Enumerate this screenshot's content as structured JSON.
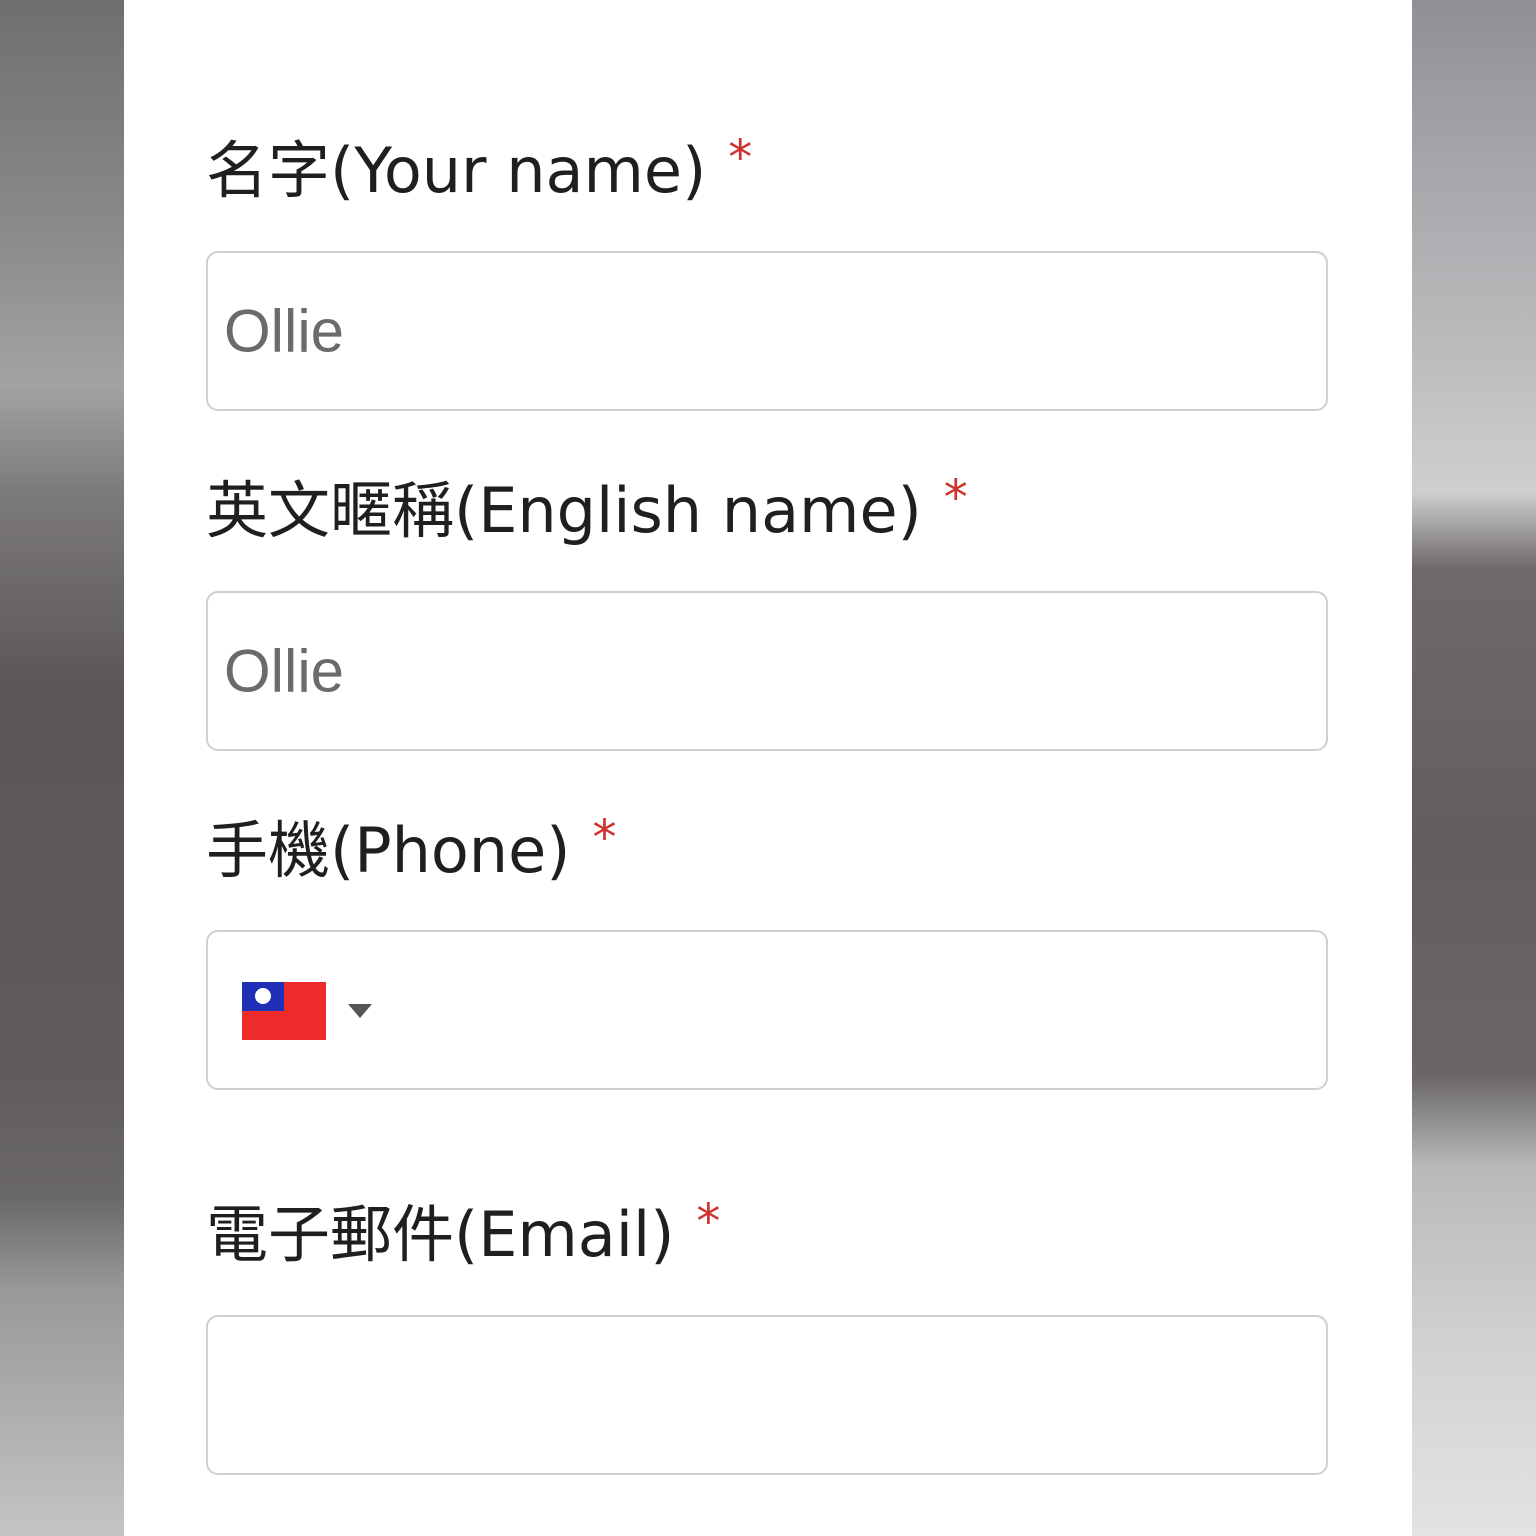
{
  "form": {
    "name": {
      "label": "名字(Your name)",
      "required_mark": "*",
      "value": "Ollie"
    },
    "english_name": {
      "label": "英文暱稱(English name)",
      "required_mark": "*",
      "value": "Ollie"
    },
    "phone": {
      "label": "手機(Phone)",
      "required_mark": "*",
      "country_flag": "taiwan-flag-icon",
      "value": ""
    },
    "email": {
      "label": "電子郵件(Email)",
      "required_mark": "*",
      "value": ""
    }
  },
  "colors": {
    "required": "#d0312d",
    "label_text": "#1f1f1f",
    "input_text": "#6b6b6b",
    "border": "#cfcfcf"
  }
}
